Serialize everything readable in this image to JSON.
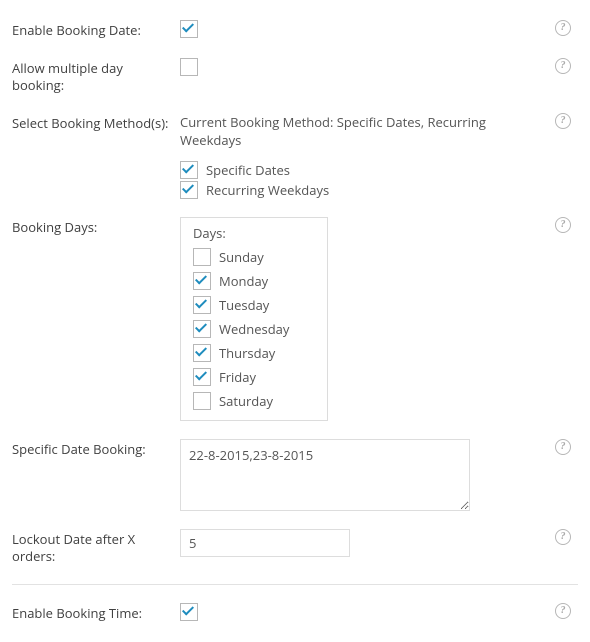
{
  "enable_booking_date": {
    "label": "Enable Booking Date:",
    "checked": true
  },
  "allow_multi_day": {
    "label": "Allow multiple day booking:",
    "checked": false
  },
  "booking_methods": {
    "label": "Select Booking Method(s):",
    "current_text": "Current Booking Method: Specific Dates, Recurring Weekdays",
    "options": [
      {
        "label": "Specific Dates",
        "checked": true
      },
      {
        "label": "Recurring Weekdays",
        "checked": true
      }
    ]
  },
  "booking_days": {
    "label": "Booking Days:",
    "legend": "Days:",
    "days": [
      {
        "label": "Sunday",
        "checked": false
      },
      {
        "label": "Monday",
        "checked": true
      },
      {
        "label": "Tuesday",
        "checked": true
      },
      {
        "label": "Wednesday",
        "checked": true
      },
      {
        "label": "Thursday",
        "checked": true
      },
      {
        "label": "Friday",
        "checked": true
      },
      {
        "label": "Saturday",
        "checked": false
      }
    ]
  },
  "specific_date": {
    "label": "Specific Date Booking:",
    "value": "22-8-2015,23-8-2015"
  },
  "lockout": {
    "label": "Lockout Date after X orders:",
    "value": "5"
  },
  "enable_booking_time": {
    "label": "Enable Booking Time:",
    "checked": true
  },
  "help_glyph": "?"
}
